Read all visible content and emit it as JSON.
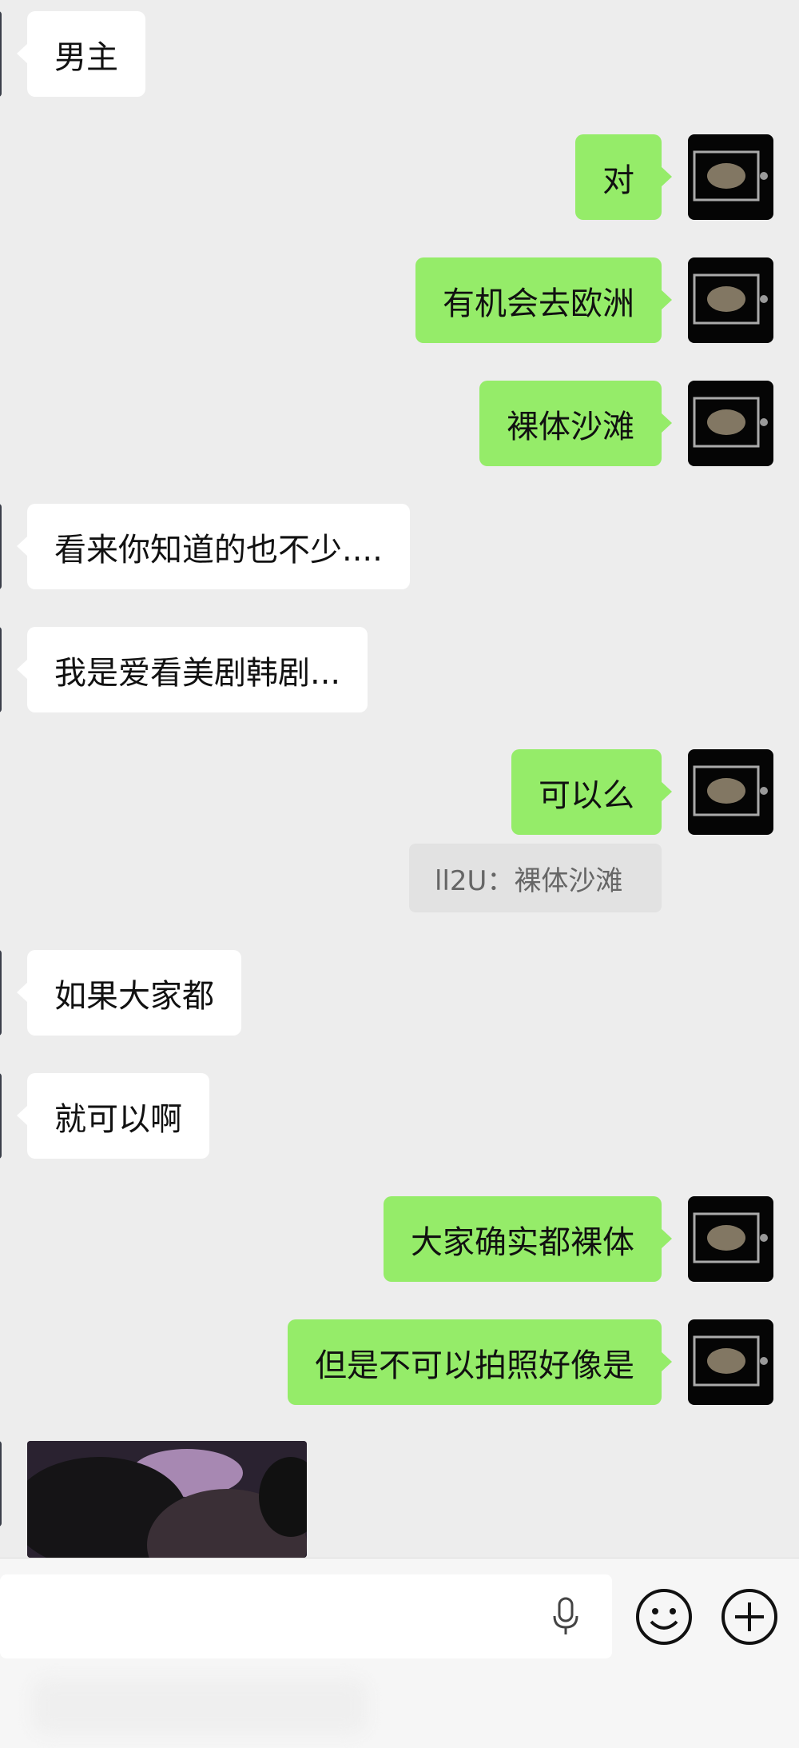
{
  "messages": [
    {
      "side": "in",
      "text": "男主"
    },
    {
      "side": "out",
      "text": "对"
    },
    {
      "side": "out",
      "text": "有机会去欧洲"
    },
    {
      "side": "out",
      "text": "裸体沙滩"
    },
    {
      "side": "in",
      "text": "看来你知道的也不少...."
    },
    {
      "side": "in",
      "text": "我是爱看美剧韩剧..."
    },
    {
      "side": "out",
      "text": "可以么",
      "quote": "ll2U：裸体沙滩"
    },
    {
      "side": "in",
      "text": "如果大家都"
    },
    {
      "side": "in",
      "text": "就可以啊"
    },
    {
      "side": "out",
      "text": "大家确实都裸体"
    },
    {
      "side": "out",
      "text": "但是不可以拍照好像是"
    }
  ],
  "input_bar": {
    "voice_icon": "microphone-icon",
    "emoji_icon": "smiley-icon",
    "more_icon": "plus-icon"
  },
  "colors": {
    "background": "#ededed",
    "outgoing_bubble": "#95ec69",
    "incoming_bubble": "#ffffff"
  }
}
